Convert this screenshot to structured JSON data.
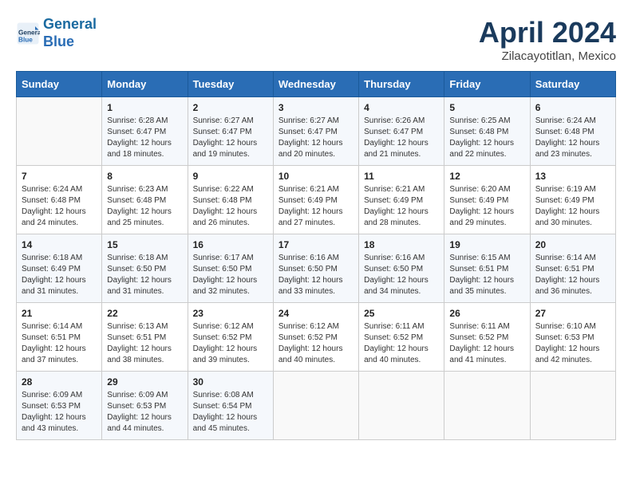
{
  "header": {
    "logo_line1": "General",
    "logo_line2": "Blue",
    "month_title": "April 2024",
    "location": "Zilacayotitlan, Mexico"
  },
  "calendar": {
    "days_of_week": [
      "Sunday",
      "Monday",
      "Tuesday",
      "Wednesday",
      "Thursday",
      "Friday",
      "Saturday"
    ],
    "weeks": [
      [
        {
          "day": "",
          "info": ""
        },
        {
          "day": "1",
          "info": "Sunrise: 6:28 AM\nSunset: 6:47 PM\nDaylight: 12 hours\nand 18 minutes."
        },
        {
          "day": "2",
          "info": "Sunrise: 6:27 AM\nSunset: 6:47 PM\nDaylight: 12 hours\nand 19 minutes."
        },
        {
          "day": "3",
          "info": "Sunrise: 6:27 AM\nSunset: 6:47 PM\nDaylight: 12 hours\nand 20 minutes."
        },
        {
          "day": "4",
          "info": "Sunrise: 6:26 AM\nSunset: 6:47 PM\nDaylight: 12 hours\nand 21 minutes."
        },
        {
          "day": "5",
          "info": "Sunrise: 6:25 AM\nSunset: 6:48 PM\nDaylight: 12 hours\nand 22 minutes."
        },
        {
          "day": "6",
          "info": "Sunrise: 6:24 AM\nSunset: 6:48 PM\nDaylight: 12 hours\nand 23 minutes."
        }
      ],
      [
        {
          "day": "7",
          "info": "Sunrise: 6:24 AM\nSunset: 6:48 PM\nDaylight: 12 hours\nand 24 minutes."
        },
        {
          "day": "8",
          "info": "Sunrise: 6:23 AM\nSunset: 6:48 PM\nDaylight: 12 hours\nand 25 minutes."
        },
        {
          "day": "9",
          "info": "Sunrise: 6:22 AM\nSunset: 6:48 PM\nDaylight: 12 hours\nand 26 minutes."
        },
        {
          "day": "10",
          "info": "Sunrise: 6:21 AM\nSunset: 6:49 PM\nDaylight: 12 hours\nand 27 minutes."
        },
        {
          "day": "11",
          "info": "Sunrise: 6:21 AM\nSunset: 6:49 PM\nDaylight: 12 hours\nand 28 minutes."
        },
        {
          "day": "12",
          "info": "Sunrise: 6:20 AM\nSunset: 6:49 PM\nDaylight: 12 hours\nand 29 minutes."
        },
        {
          "day": "13",
          "info": "Sunrise: 6:19 AM\nSunset: 6:49 PM\nDaylight: 12 hours\nand 30 minutes."
        }
      ],
      [
        {
          "day": "14",
          "info": "Sunrise: 6:18 AM\nSunset: 6:49 PM\nDaylight: 12 hours\nand 31 minutes."
        },
        {
          "day": "15",
          "info": "Sunrise: 6:18 AM\nSunset: 6:50 PM\nDaylight: 12 hours\nand 31 minutes."
        },
        {
          "day": "16",
          "info": "Sunrise: 6:17 AM\nSunset: 6:50 PM\nDaylight: 12 hours\nand 32 minutes."
        },
        {
          "day": "17",
          "info": "Sunrise: 6:16 AM\nSunset: 6:50 PM\nDaylight: 12 hours\nand 33 minutes."
        },
        {
          "day": "18",
          "info": "Sunrise: 6:16 AM\nSunset: 6:50 PM\nDaylight: 12 hours\nand 34 minutes."
        },
        {
          "day": "19",
          "info": "Sunrise: 6:15 AM\nSunset: 6:51 PM\nDaylight: 12 hours\nand 35 minutes."
        },
        {
          "day": "20",
          "info": "Sunrise: 6:14 AM\nSunset: 6:51 PM\nDaylight: 12 hours\nand 36 minutes."
        }
      ],
      [
        {
          "day": "21",
          "info": "Sunrise: 6:14 AM\nSunset: 6:51 PM\nDaylight: 12 hours\nand 37 minutes."
        },
        {
          "day": "22",
          "info": "Sunrise: 6:13 AM\nSunset: 6:51 PM\nDaylight: 12 hours\nand 38 minutes."
        },
        {
          "day": "23",
          "info": "Sunrise: 6:12 AM\nSunset: 6:52 PM\nDaylight: 12 hours\nand 39 minutes."
        },
        {
          "day": "24",
          "info": "Sunrise: 6:12 AM\nSunset: 6:52 PM\nDaylight: 12 hours\nand 40 minutes."
        },
        {
          "day": "25",
          "info": "Sunrise: 6:11 AM\nSunset: 6:52 PM\nDaylight: 12 hours\nand 40 minutes."
        },
        {
          "day": "26",
          "info": "Sunrise: 6:11 AM\nSunset: 6:52 PM\nDaylight: 12 hours\nand 41 minutes."
        },
        {
          "day": "27",
          "info": "Sunrise: 6:10 AM\nSunset: 6:53 PM\nDaylight: 12 hours\nand 42 minutes."
        }
      ],
      [
        {
          "day": "28",
          "info": "Sunrise: 6:09 AM\nSunset: 6:53 PM\nDaylight: 12 hours\nand 43 minutes."
        },
        {
          "day": "29",
          "info": "Sunrise: 6:09 AM\nSunset: 6:53 PM\nDaylight: 12 hours\nand 44 minutes."
        },
        {
          "day": "30",
          "info": "Sunrise: 6:08 AM\nSunset: 6:54 PM\nDaylight: 12 hours\nand 45 minutes."
        },
        {
          "day": "",
          "info": ""
        },
        {
          "day": "",
          "info": ""
        },
        {
          "day": "",
          "info": ""
        },
        {
          "day": "",
          "info": ""
        }
      ]
    ]
  }
}
